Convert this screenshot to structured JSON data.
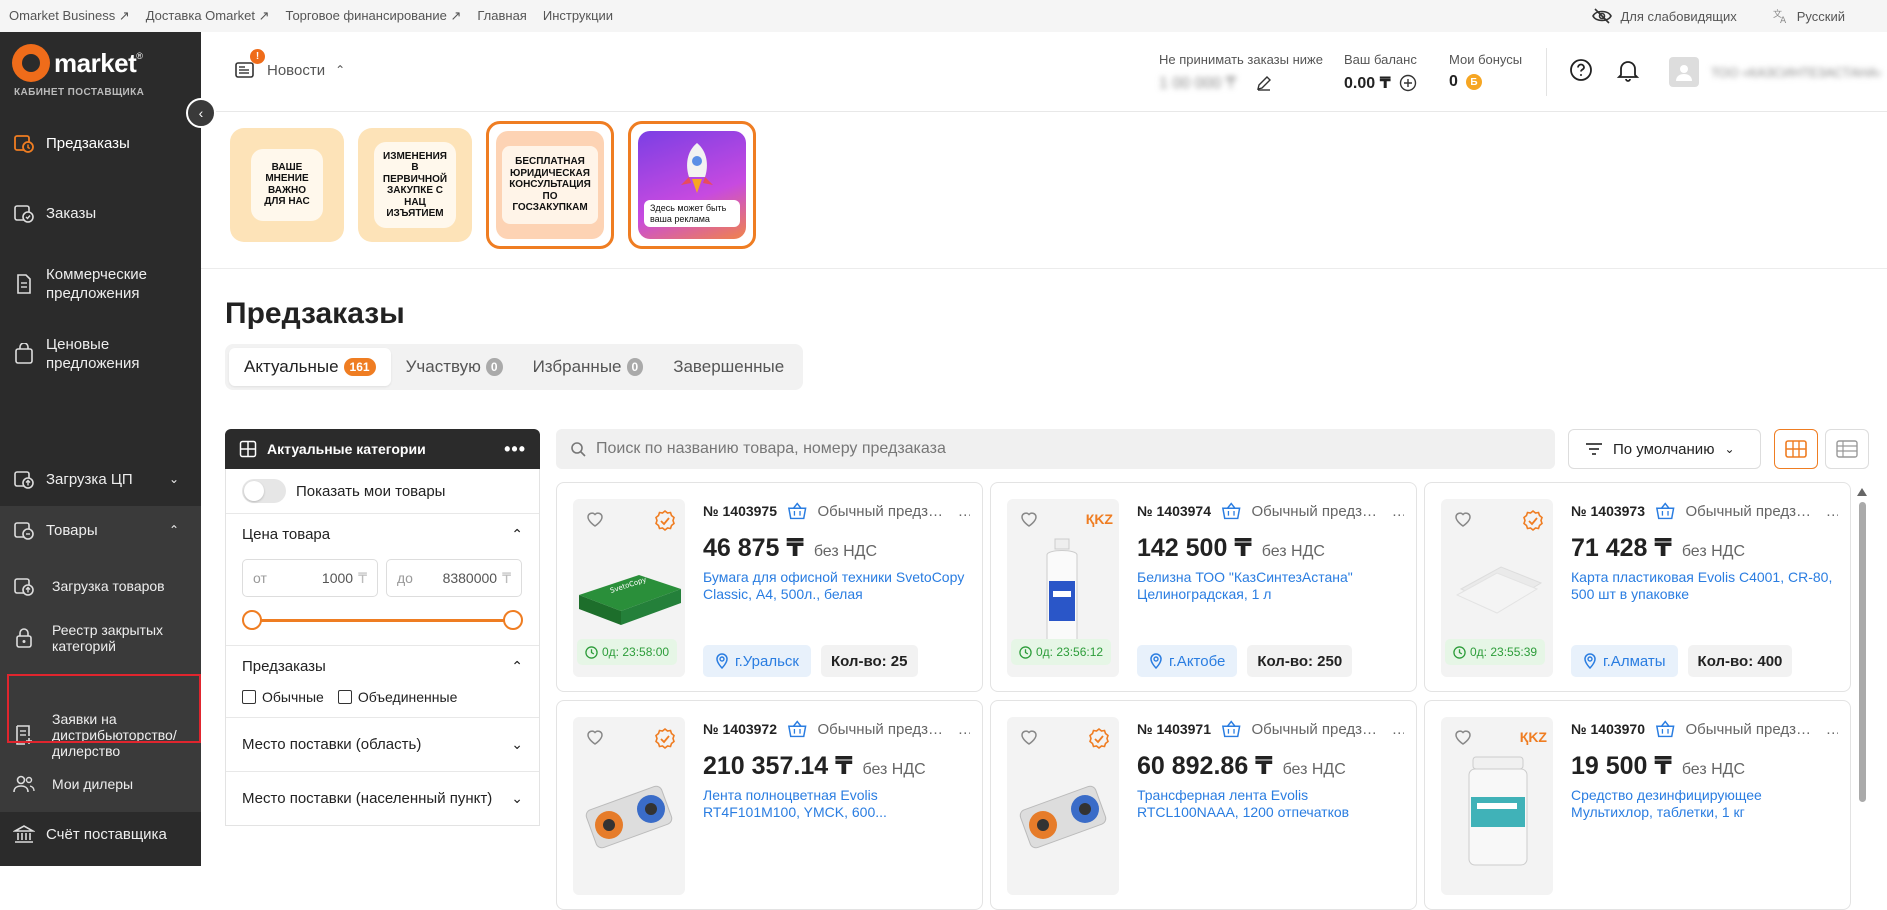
{
  "topbar": {
    "links": [
      "Omarket Business ↗",
      "Доставка Omarket ↗",
      "Торговое финансирование ↗",
      "Главная",
      "Инструкции"
    ],
    "accessibility": "Для слабовидящих",
    "language": "Русский"
  },
  "sidebar": {
    "logo_text": "market",
    "logo_sub": "КАБИНЕТ ПОСТАВЩИКА",
    "items": [
      {
        "label": "Предзаказы",
        "icon": "preorder-icon"
      },
      {
        "label": "Заказы",
        "icon": "orders-icon"
      },
      {
        "label": "Коммерческие предложения",
        "icon": "document-icon"
      },
      {
        "label": "Ценовые предложения",
        "icon": "bag-icon"
      },
      {
        "label": "Загрузка ЦП",
        "icon": "upload-icon"
      },
      {
        "label": "Товары",
        "icon": "goods-icon"
      }
    ],
    "sub_items": [
      {
        "label": "Загрузка товаров",
        "icon": "upload-goods-icon"
      },
      {
        "label": "Реестр закрытых категорий",
        "icon": "lock-icon"
      },
      {
        "label": "Заявки на дистрибьюторство/дилерство",
        "icon": "request-icon"
      },
      {
        "label": "Мои дилеры",
        "icon": "users-icon"
      }
    ],
    "account": {
      "label": "Счёт поставщика",
      "icon": "bank-icon"
    }
  },
  "header": {
    "news_label": "Новости",
    "news_badge": "!",
    "min_order_label": "Не принимать заказы ниже",
    "min_order_value": "1 00 000 ₸",
    "balance_label": "Ваш баланс",
    "balance_value": "0.00 ₸",
    "bonus_label": "Мои бонусы",
    "bonus_value": "0",
    "user_name": "ТОО «КАЗСИНТЕЗАСТАНА»"
  },
  "stories": [
    {
      "text": "ВАШЕ МНЕНИЕ ВАЖНО ДЛЯ НАС",
      "bg": "#fde3b8"
    },
    {
      "text": "ИЗМЕНЕНИЯ В ПЕРВИЧНОЙ ЗАКУПКЕ С НАЦ ИЗЪЯТИЕМ",
      "bg": "#fde3b8"
    },
    {
      "text": "БЕСПЛАТНАЯ ЮРИДИЧЕСКАЯ КОНСУЛЬТАЦИЯ ПО ГОСЗАКУПКАМ",
      "bg": "#fdd3b4"
    },
    {
      "text": "Здесь может быть ваша реклама",
      "bg": "#a246e6"
    }
  ],
  "page": {
    "title": "Предзаказы",
    "tabs": [
      {
        "label": "Актуальные",
        "count": "161"
      },
      {
        "label": "Участвую",
        "count": "0"
      },
      {
        "label": "Избранные",
        "count": "0"
      },
      {
        "label": "Завершенные",
        "count": ""
      }
    ]
  },
  "filters": {
    "header": "Актуальные категории",
    "show_mine": "Показать мои товары",
    "price_label": "Цена товара",
    "from_label": "от",
    "from_value": "1000",
    "to_label": "до",
    "to_value": "8380000",
    "currency": "₸",
    "preorders_label": "Предзаказы",
    "cb_regular": "Обычные",
    "cb_merged": "Объединенные",
    "region_label": "Место поставки (область)",
    "locality_label": "Место поставки (населенный пункт)"
  },
  "search": {
    "placeholder": "Поиск по названию товара, номеру предзаказа"
  },
  "sort": {
    "label": "По умолчанию"
  },
  "products": [
    {
      "num": "№ 1403975",
      "type": "Обычный предзаказ",
      "price": "46 875 ₸",
      "nds": "без НДС",
      "name": "Бумага для офисной техники SvetoCopy Classic, А4, 500л., белая",
      "timer": "0д: 23:58:00",
      "city": "г.Уральск",
      "qty": "Кол-во: 25",
      "badge": "verified",
      "img": "paper"
    },
    {
      "num": "№ 1403974",
      "type": "Обычный предзаказ",
      "price": "142 500 ₸",
      "nds": "без НДС",
      "name": "Белизна ТОО \"КазСинтезАстана\" Целиноградская, 1 л",
      "timer": "0д: 23:56:12",
      "city": "г.Актобе",
      "qty": "Кол-во: 250",
      "badge": "kz",
      "img": "bottle"
    },
    {
      "num": "№ 1403973",
      "type": "Обычный предзаказ",
      "price": "71 428 ₸",
      "nds": "без НДС",
      "name": "Карта пластиковая Evolis C4001, CR-80, 500 шт в упаковке",
      "timer": "0д: 23:55:39",
      "city": "г.Алматы",
      "qty": "Кол-во: 400",
      "badge": "verified",
      "img": "cards"
    },
    {
      "num": "№ 1403972",
      "type": "Обычный предзаказ",
      "price": "210 357.14 ₸",
      "nds": "без НДС",
      "name": "Лента полноцветная Evolis RT4F101M100, YMCK, 600...",
      "timer": "",
      "city": "",
      "qty": "",
      "badge": "verified",
      "img": "ribbon"
    },
    {
      "num": "№ 1403971",
      "type": "Обычный предзаказ",
      "price": "60 892.86 ₸",
      "nds": "без НДС",
      "name": "Трансферная лента Evolis RTCL100NAAA, 1200 отпечатков",
      "timer": "",
      "city": "",
      "qty": "",
      "badge": "verified",
      "img": "ribbon"
    },
    {
      "num": "№ 1403970",
      "type": "Обычный предзаказ",
      "price": "19 500 ₸",
      "nds": "без НДС",
      "name": "Средство дезинфицирующее Мультихлор, таблетки, 1 кг",
      "timer": "",
      "city": "",
      "qty": "",
      "badge": "kz",
      "img": "jar"
    }
  ],
  "colors": {
    "accent": "#ef7d22",
    "link": "#2a7de1",
    "sidebar": "#2b2b2b",
    "highlight": "#e0252e"
  }
}
